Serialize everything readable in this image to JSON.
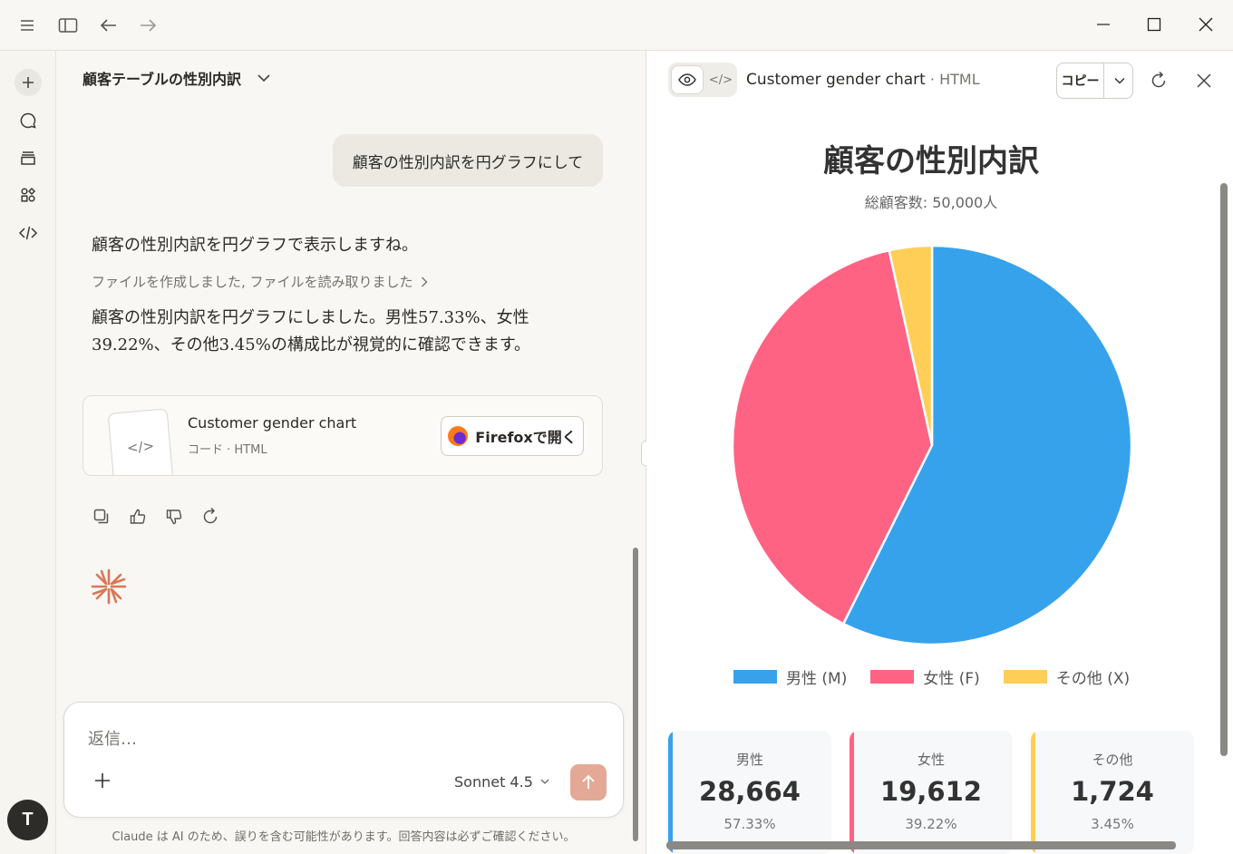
{
  "titlebar": {
    "icons": [
      "menu-icon",
      "sidebar-toggle-icon",
      "arrow-left-icon",
      "arrow-right-icon",
      "minimize-icon",
      "maximize-icon",
      "close-icon"
    ]
  },
  "rail": {
    "icons": [
      "plus-icon",
      "chat-bubble-icon",
      "projects-icon",
      "artifacts-icon",
      "code-icon"
    ],
    "avatar_initial": "T"
  },
  "conversation": {
    "title": "顧客テーブルの性別内訳",
    "user_message": "顧客の性別内訳を円グラフにして",
    "assistant_intro": "顧客の性別内訳を円グラフで表示しますね。",
    "tool_summary": "ファイルを作成しました, ファイルを読み取りました",
    "assistant_result": "顧客の性別内訳を円グラフにしました。男性57.33%、女性39.22%、その他3.45%の構成比が視覚的に確認できます。",
    "artifact": {
      "title": "Customer gender chart",
      "subtitle": "コード · HTML",
      "thumb_glyph": "</>",
      "open_label": "Firefoxで開く"
    }
  },
  "composer": {
    "placeholder": "返信…",
    "model": "Sonnet 4.5",
    "disclaimer": "Claude は AI のため、誤りを含む可能性があります。回答内容は必ずご確認ください。"
  },
  "panel": {
    "toggle_code_glyph": "</>",
    "title": "Customer gender chart",
    "title_suffix": " · HTML",
    "copy_label": "コピー"
  },
  "chart_page": {
    "title": "顧客の性別内訳",
    "subtitle": "総顧客数: 50,000人",
    "stats": [
      {
        "label": "男性",
        "value": "28,664",
        "pct": "57.33%",
        "color": "#36a2eb"
      },
      {
        "label": "女性",
        "value": "19,612",
        "pct": "39.22%",
        "color": "#ff6384"
      },
      {
        "label": "その他",
        "value": "1,724",
        "pct": "3.45%",
        "color": "#ffce56"
      }
    ]
  },
  "chart_data": {
    "type": "pie",
    "title": "顧客の性別内訳",
    "categories": [
      "男性 (M)",
      "女性 (F)",
      "その他 (X)"
    ],
    "values": [
      28664,
      19612,
      1724
    ],
    "colors": [
      "#36a2eb",
      "#ff6384",
      "#ffce56"
    ],
    "legend_position": "bottom"
  }
}
